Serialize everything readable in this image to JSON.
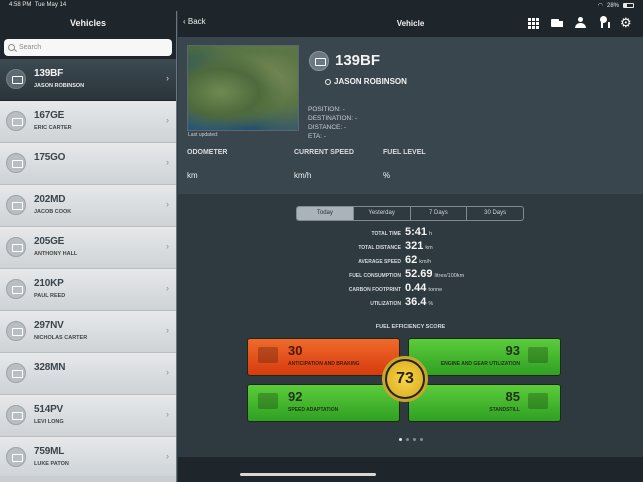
{
  "status": {
    "time": "4:58 PM",
    "date": "Tue May 14",
    "battery": "28%"
  },
  "sidebar": {
    "title": "Vehicles",
    "search_placeholder": "Search",
    "vehicles": [
      {
        "reg": "139BF",
        "driver": "JASON ROBINSON",
        "selected": true
      },
      {
        "reg": "167GE",
        "driver": "ERIC CARTER"
      },
      {
        "reg": "175GO",
        "driver": ""
      },
      {
        "reg": "202MD",
        "driver": "JACOB COOK"
      },
      {
        "reg": "205GE",
        "driver": "ANTHONY HALL"
      },
      {
        "reg": "210KP",
        "driver": "PAUL REED"
      },
      {
        "reg": "297NV",
        "driver": "NICHOLAS CARTER"
      },
      {
        "reg": "328MN",
        "driver": ""
      },
      {
        "reg": "514PV",
        "driver": "LEVI LONG"
      },
      {
        "reg": "759ML",
        "driver": "LUKE PATON"
      }
    ]
  },
  "header": {
    "back": "Back",
    "title": "Vehicle"
  },
  "vehicle": {
    "reg": "139BF",
    "driver": "JASON ROBINSON",
    "last_updated": "Last updated:",
    "position": "POSITION: -",
    "destination": "DESTINATION: -",
    "distance": "DISTANCE: -",
    "eta": "ETA: -",
    "odometer_label": "ODOMETER",
    "odometer_unit": "km",
    "speed_label": "CURRENT SPEED",
    "speed_unit": "km/h",
    "fuel_label": "FUEL LEVEL",
    "fuel_unit": "%"
  },
  "tabs": [
    "Today",
    "Yesterday",
    "7 Days",
    "30 Days"
  ],
  "stats": {
    "total_time": {
      "label": "TOTAL TIME",
      "value": "5:41",
      "unit": "h"
    },
    "total_distance": {
      "label": "TOTAL DISTANCE",
      "value": "321",
      "unit": "km"
    },
    "average_speed": {
      "label": "AVERAGE SPEED",
      "value": "62",
      "unit": "km/h"
    },
    "fuel_consumption": {
      "label": "FUEL CONSUMPTION",
      "value": "52.69",
      "unit": "litres/100km"
    },
    "carbon_footprint": {
      "label": "CARBON FOOTPRINT",
      "value": "0.44",
      "unit": "tonne"
    },
    "utilization": {
      "label": "UTILIZATION",
      "value": "36.4",
      "unit": "%"
    }
  },
  "efficiency": {
    "title": "FUEL EFFICIENCY SCORE",
    "overall": "73",
    "anticipation": {
      "score": "30",
      "label": "ANTICIPATION AND BRAKING"
    },
    "engine": {
      "score": "93",
      "label": "ENGINE AND GEAR UTILIZATION"
    },
    "speed": {
      "score": "92",
      "label": "SPEED ADAPTATION"
    },
    "standstill": {
      "score": "85",
      "label": "STANDSTILL"
    },
    "colors": {
      "bad": "#e4501c",
      "good": "#44b42e",
      "center": "#f0c83a"
    }
  }
}
